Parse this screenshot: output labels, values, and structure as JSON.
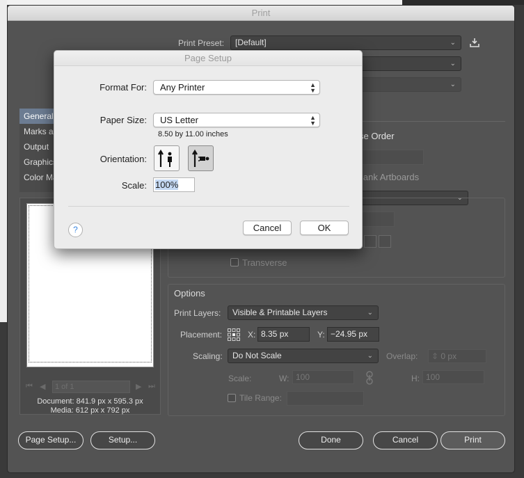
{
  "print": {
    "title": "Print",
    "preset_label": "Print Preset:",
    "preset_value": "[Default]",
    "side_items": [
      "General",
      "Marks and Bleeds",
      "Output",
      "Graphics",
      "Color Management"
    ],
    "page_order_fragment": "se Order",
    "blank_artboards_fragment": "lank Artboards",
    "transverse_label": "Transverse",
    "options_title": "Options",
    "print_layers_label": "Print Layers:",
    "print_layers_value": "Visible & Printable Layers",
    "placement_label": "Placement:",
    "x_label": "X:",
    "x_value": "8.35 px",
    "y_label": "Y:",
    "y_value": "−24.95 px",
    "scaling_label": "Scaling:",
    "scaling_value": "Do Not Scale",
    "overlap_label": "Overlap:",
    "overlap_value": "0 px",
    "scale_label": "Scale:",
    "w_label": "W:",
    "w_value": "100",
    "h_label": "H:",
    "h_value": "100",
    "tile_range_label": "Tile Range:",
    "pager_value": "1 of 1",
    "document_info": "Document: 841.9 px x 595.3 px",
    "media_info": "Media: 612 px x 792 px",
    "buttons": {
      "page_setup": "Page Setup...",
      "setup": "Setup...",
      "done": "Done",
      "cancel": "Cancel",
      "print": "Print"
    }
  },
  "page_setup": {
    "title": "Page Setup",
    "format_for_label": "Format For:",
    "format_for_value": "Any Printer",
    "paper_size_label": "Paper Size:",
    "paper_size_value": "US Letter",
    "paper_dims": "8.50 by 11.00 inches",
    "orientation_label": "Orientation:",
    "scale_label": "Scale:",
    "scale_value": "100%",
    "help_glyph": "?",
    "cancel_label": "Cancel",
    "ok_label": "OK"
  },
  "icons": {
    "download": "download-preset-icon",
    "portrait": "portrait-orientation-icon",
    "landscape": "landscape-orientation-icon",
    "placement": "placement-grid-icon",
    "link": "link-icon"
  }
}
